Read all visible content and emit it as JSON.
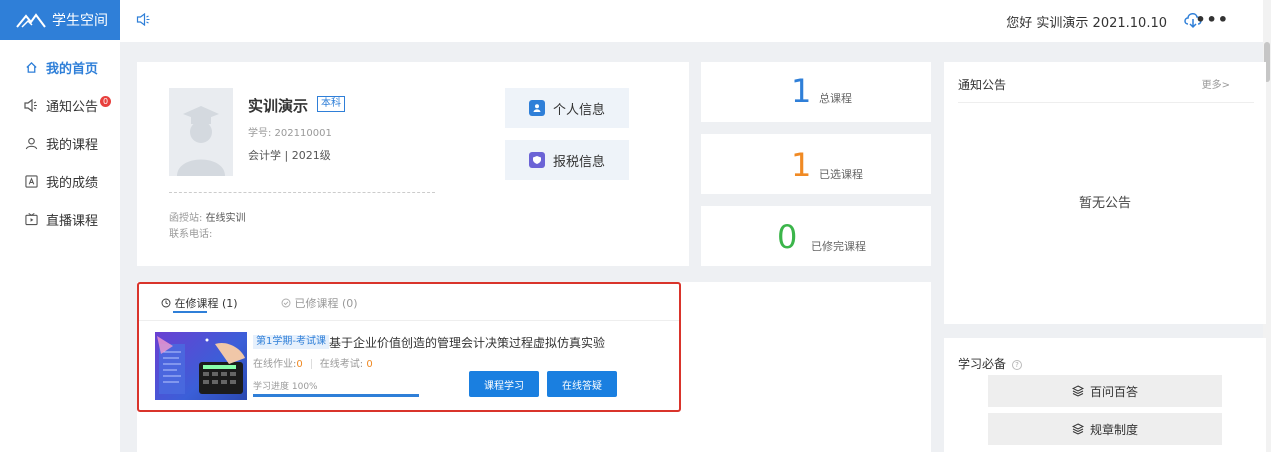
{
  "sidebar": {
    "logo_text": "学生空间",
    "items": [
      {
        "label": "我的首页",
        "icon": "home-icon"
      },
      {
        "label": "通知公告",
        "icon": "speaker-icon",
        "badge": "0"
      },
      {
        "label": "我的课程",
        "icon": "user-icon"
      },
      {
        "label": "我的成绩",
        "icon": "grade-icon"
      },
      {
        "label": "直播课程",
        "icon": "live-tv-icon"
      }
    ]
  },
  "topbar": {
    "greeting": "您好 实训演示 2021.10.10"
  },
  "profile": {
    "name": "实训演示",
    "level_tag": "本科",
    "student_id": "学号: 202110001",
    "major": "会计学 | 2021级",
    "station_label": "函授站:",
    "station_value": "在线实训",
    "phone_label": "联系电话:",
    "btn_personal": "个人信息",
    "btn_tax": "报税信息"
  },
  "stats": [
    {
      "value": "1",
      "label": "总课程",
      "color": "#2f7fd8"
    },
    {
      "value": "1",
      "label": "已选课程",
      "color": "#f08a24"
    },
    {
      "value": "0",
      "label": "已修完课程",
      "color": "#3bb54a"
    }
  ],
  "notice": {
    "title": "通知公告",
    "more": "更多>",
    "empty": "暂无公告"
  },
  "study": {
    "title": "学习必备",
    "buttons": [
      "百问百答",
      "规章制度"
    ]
  },
  "courses": {
    "tab_active": "在修课程 (1)",
    "tab_done": "已修课程 (0)",
    "item": {
      "tag": "第1学期-考试课",
      "title": "基于企业价值创造的管理会计决策过程虚拟仿真实验",
      "homework_label": "在线作业:",
      "homework_value": "0",
      "exam_label": "在线考试:",
      "exam_value": "0",
      "progress_label": "学习进度 100%",
      "progress": 1.0,
      "btn_study": "课程学习",
      "btn_qa": "在线答疑"
    }
  }
}
